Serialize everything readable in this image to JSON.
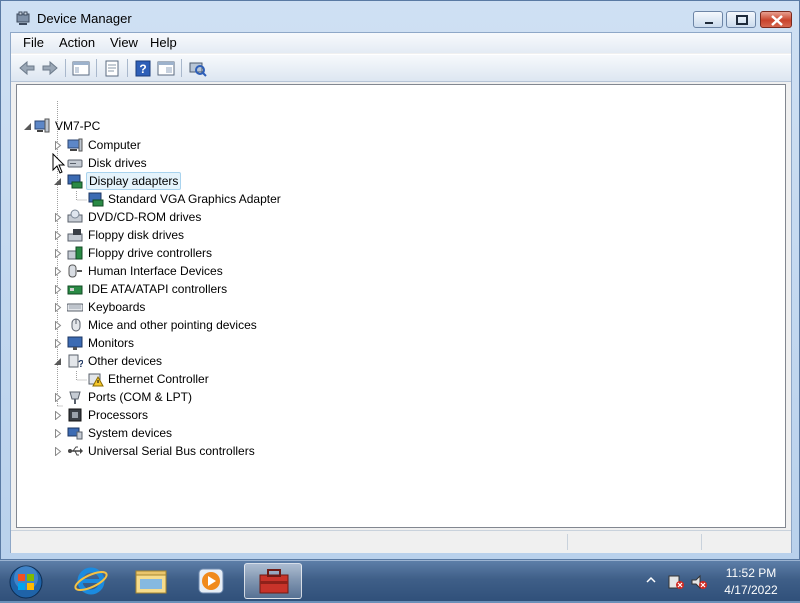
{
  "window": {
    "title": "Device Manager",
    "icon": "device-manager-icon",
    "controls": {
      "minimize": "minimize-icon",
      "maximize": "maximize-icon",
      "close": "close-icon"
    }
  },
  "menu": {
    "items": [
      "File",
      "Action",
      "View",
      "Help"
    ]
  },
  "toolbar": {
    "buttons": [
      "back-arrow-icon",
      "forward-arrow-icon",
      "show-hide-tree-icon",
      "properties-icon",
      "help-icon",
      "view-pane-icon",
      "scan-hardware-icon"
    ]
  },
  "tree": {
    "root": "VM7-PC",
    "nodes": [
      {
        "label": "Computer",
        "icon": "computer-icon",
        "expanded": false
      },
      {
        "label": "Disk drives",
        "icon": "disk-drive-icon",
        "expanded": false
      },
      {
        "label": "Display adapters",
        "icon": "display-adapter-icon",
        "expanded": true,
        "selected": true
      },
      {
        "label": "Standard VGA Graphics Adapter",
        "icon": "display-adapter-icon",
        "child": true
      },
      {
        "label": "DVD/CD-ROM drives",
        "icon": "dvd-drive-icon",
        "expanded": false
      },
      {
        "label": "Floppy disk drives",
        "icon": "floppy-disk-icon",
        "expanded": false
      },
      {
        "label": "Floppy drive controllers",
        "icon": "floppy-controller-icon",
        "expanded": false
      },
      {
        "label": "Human Interface Devices",
        "icon": "hid-icon",
        "expanded": false
      },
      {
        "label": "IDE ATA/ATAPI controllers",
        "icon": "ide-controller-icon",
        "expanded": false
      },
      {
        "label": "Keyboards",
        "icon": "keyboard-icon",
        "expanded": false
      },
      {
        "label": "Mice and other pointing devices",
        "icon": "mouse-icon",
        "expanded": false
      },
      {
        "label": "Monitors",
        "icon": "monitor-icon",
        "expanded": false
      },
      {
        "label": "Other devices",
        "icon": "other-devices-icon",
        "expanded": true
      },
      {
        "label": "Ethernet Controller",
        "icon": "warning-device-icon",
        "child": true
      },
      {
        "label": "Ports (COM & LPT)",
        "icon": "port-icon",
        "expanded": false
      },
      {
        "label": "Processors",
        "icon": "processor-icon",
        "expanded": false
      },
      {
        "label": "System devices",
        "icon": "system-device-icon",
        "expanded": false
      },
      {
        "label": "Universal Serial Bus controllers",
        "icon": "usb-icon",
        "expanded": false
      }
    ]
  },
  "taskbar": {
    "apps": [
      "start-orb-icon",
      "internet-explorer-icon",
      "windows-explorer-icon",
      "media-player-icon",
      "device-manager-taskbar-icon"
    ],
    "tray": {
      "time": "11:52 PM",
      "date": "4/17/2022"
    }
  },
  "colors": {
    "accent": "#3399ff",
    "selection": "#e5f3fb",
    "taskbar": "#3f5f88"
  }
}
